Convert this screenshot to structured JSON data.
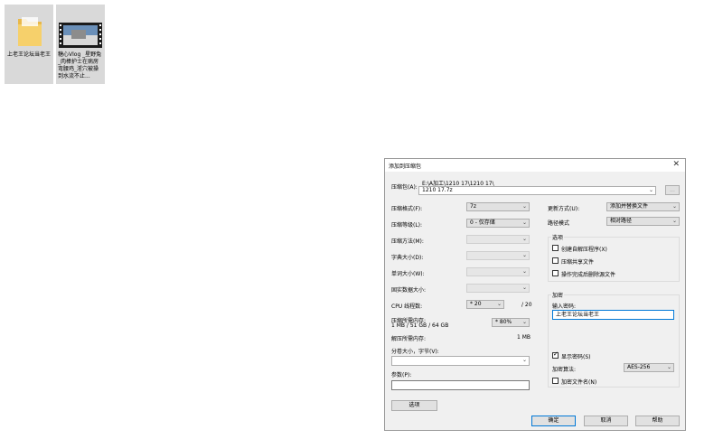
{
  "desktop": {
    "icons": [
      {
        "label": "上老王论坛当老王"
      },
      {
        "label": "糖心Vlog _星野兔_肉棒护士在病房弯腰鸡_淫穴被操到水流不止..."
      }
    ]
  },
  "dialog": {
    "title": "添加到压缩包",
    "archive_label": "压缩包(A):",
    "archive_path": "E:\\A加工\\1210 17\\1210 17\\",
    "archive_name": "1210 17.7z",
    "browse_label": "...",
    "left": {
      "format_label": "压缩格式(F):",
      "format_value": "7z",
      "level_label": "压缩等级(L):",
      "level_value": "0 - 仅存储",
      "method_label": "压缩方法(M):",
      "dict_label": "字典大小(D):",
      "word_label": "单词大小(W):",
      "solid_label": "固实数据大小:",
      "cpu_label": "CPU 线程数:",
      "cpu_value": "* 20",
      "cpu_total": "/ 20",
      "mem_label": "压缩所需内存:",
      "mem_detail": "1 MB / 51 GB / 64 GB",
      "mem_value": "* 80%",
      "decomp_label": "解压所需内存:",
      "decomp_value": "1 MB",
      "split_label": "分卷大小，字节(V):",
      "params_label": "参数(P):",
      "options_button": "选项"
    },
    "right": {
      "update_label": "更新方式(U):",
      "update_value": "添加并替换文件",
      "path_label": "路径模式",
      "path_value": "相对路径",
      "options_group": "选项",
      "opt_sfx": "创建自解压程序(X)",
      "opt_shared": "压缩共享文件",
      "opt_delete": "操作完成后删除源文件",
      "enc_group": "加密",
      "pwd_label": "输入密码:",
      "pwd_value": "上老王论坛当老王",
      "show_pwd": "显示密码(S)",
      "alg_label": "加密算法:",
      "alg_value": "AES-256",
      "enc_names": "加密文件名(N)"
    },
    "buttons": {
      "ok": "确定",
      "cancel": "取消",
      "help": "帮助"
    }
  }
}
